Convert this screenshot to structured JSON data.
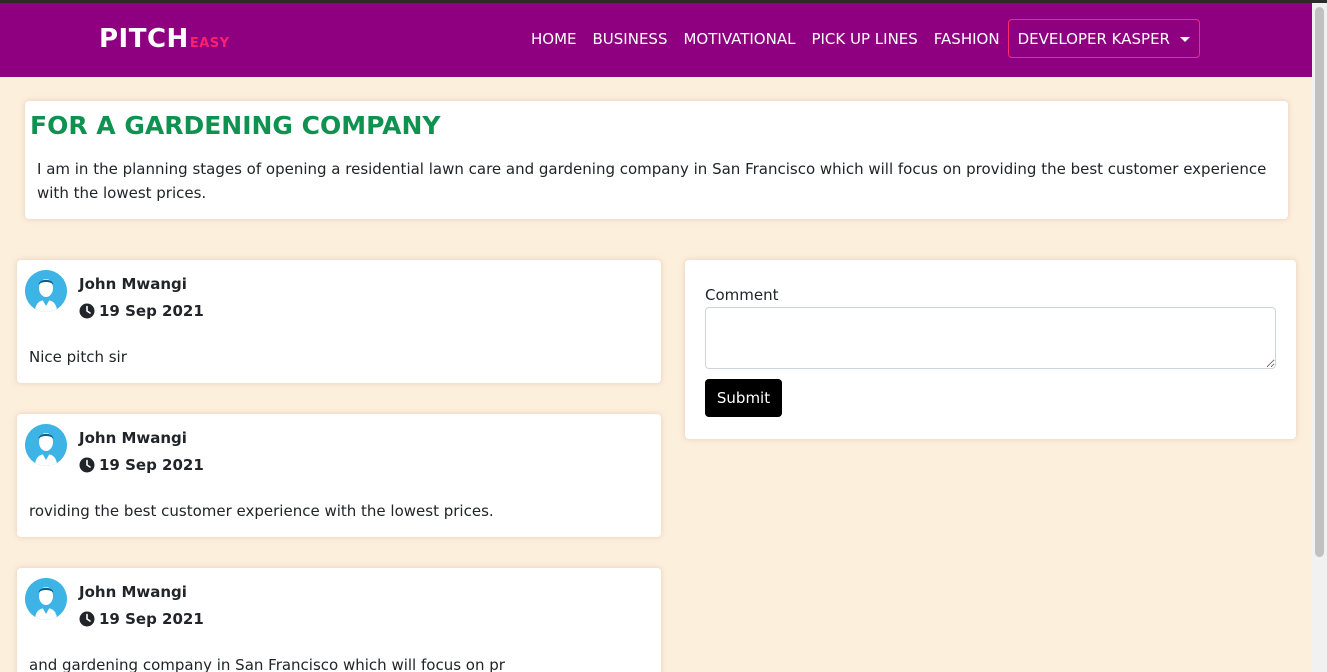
{
  "brand": {
    "main": "PITCH",
    "sub": "EASY"
  },
  "nav": {
    "links": [
      "HOME",
      "BUSINESS",
      "MOTIVATIONAL",
      "PICK UP LINES",
      "FASHION"
    ],
    "user_menu": "DEVELOPER KASPER"
  },
  "pitch": {
    "title": "FOR A GARDENING COMPANY",
    "description": "I am in the planning stages of opening a residential lawn care and gardening company in San Francisco which will focus on providing the best customer experience with the lowest prices."
  },
  "comments": [
    {
      "author": "John Mwangi",
      "date": "19 Sep 2021",
      "text": "Nice pitch sir"
    },
    {
      "author": "John Mwangi",
      "date": "19 Sep 2021",
      "text": "roviding the best customer experience with the lowest prices."
    },
    {
      "author": "John Mwangi",
      "date": "19 Sep 2021",
      "text": "and gardening company in San Francisco which will focus on pr"
    }
  ],
  "form": {
    "label": "Comment",
    "value": "",
    "submit_label": "Submit"
  },
  "colors": {
    "navbar": "#8e0080",
    "brand_accent": "#ff1f6f",
    "pitch_title": "#0f9150",
    "background": "#fcefdc",
    "avatar": "#3db4e5"
  }
}
